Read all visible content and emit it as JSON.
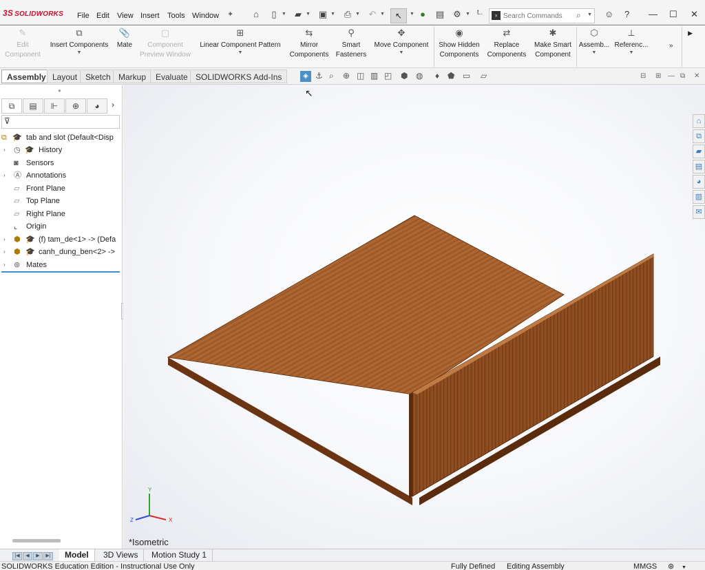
{
  "app": {
    "logo_text": "SOLIDWORKS",
    "logo_mark": "3S"
  },
  "menu": {
    "items": [
      "File",
      "Edit",
      "View",
      "Insert",
      "Tools",
      "Window"
    ]
  },
  "search": {
    "placeholder": "Search Commands"
  },
  "ribbon": {
    "buttons": [
      {
        "label": "Edit Component",
        "icon": "edit-component-icon",
        "disabled": true
      },
      {
        "label": "Insert Components",
        "icon": "insert-components-icon",
        "disabled": false
      },
      {
        "label": "Mate",
        "icon": "mate-icon",
        "disabled": false
      },
      {
        "label": "Component Preview Window",
        "icon": "component-preview-icon",
        "disabled": true
      },
      {
        "label": "Linear Component Pattern",
        "icon": "linear-pattern-icon",
        "disabled": false
      },
      {
        "label": "Mirror Components",
        "icon": "mirror-icon",
        "disabled": false
      },
      {
        "label": "Smart Fasteners",
        "icon": "smart-fasteners-icon",
        "disabled": false
      },
      {
        "label": "Move Component",
        "icon": "move-component-icon",
        "disabled": false
      },
      {
        "label": "Show Hidden Components",
        "icon": "show-hidden-icon",
        "disabled": false
      },
      {
        "label": "Replace Components",
        "icon": "replace-icon",
        "disabled": false
      },
      {
        "label": "Make Smart Component",
        "icon": "make-smart-icon",
        "disabled": false
      },
      {
        "label": "Assemb...",
        "icon": "assembly-features-icon",
        "disabled": false
      },
      {
        "label": "Referenc...",
        "icon": "reference-geometry-icon",
        "disabled": false
      }
    ]
  },
  "tabs": {
    "items": [
      "Assembly",
      "Layout",
      "Sketch",
      "Markup",
      "Evaluate",
      "SOLIDWORKS Add-Ins"
    ],
    "active": "Assembly"
  },
  "tree": {
    "root": "tab and slot  (Default<Disp",
    "items": [
      {
        "label": "History",
        "expandable": true
      },
      {
        "label": "Sensors",
        "expandable": false
      },
      {
        "label": "Annotations",
        "expandable": true
      },
      {
        "label": "Front Plane",
        "expandable": false
      },
      {
        "label": "Top Plane",
        "expandable": false
      },
      {
        "label": "Right Plane",
        "expandable": false
      },
      {
        "label": "Origin",
        "expandable": false
      },
      {
        "label": "(f) tam_de<1> -> (Defa",
        "expandable": true
      },
      {
        "label": "canh_dung_ben<2> ->",
        "expandable": true
      },
      {
        "label": "Mates",
        "expandable": true
      }
    ]
  },
  "viewport": {
    "view_label": "*Isometric",
    "triad_labels": {
      "x": "X",
      "y": "Y",
      "z": "Z"
    }
  },
  "bottom_tabs": {
    "items": [
      "Model",
      "3D Views",
      "Motion Study 1"
    ],
    "active": "Model"
  },
  "status": {
    "edition": "SOLIDWORKS Education Edition - Instructional Use Only",
    "state": "Fully Defined",
    "mode": "Editing Assembly",
    "units": "MMGS"
  },
  "colors": {
    "brand_red": "#c8102e",
    "selection_blue": "#3c8ed6",
    "wood_top": "#a8622e",
    "wood_front": "#8a4a1f",
    "wood_side": "#6b3412"
  }
}
